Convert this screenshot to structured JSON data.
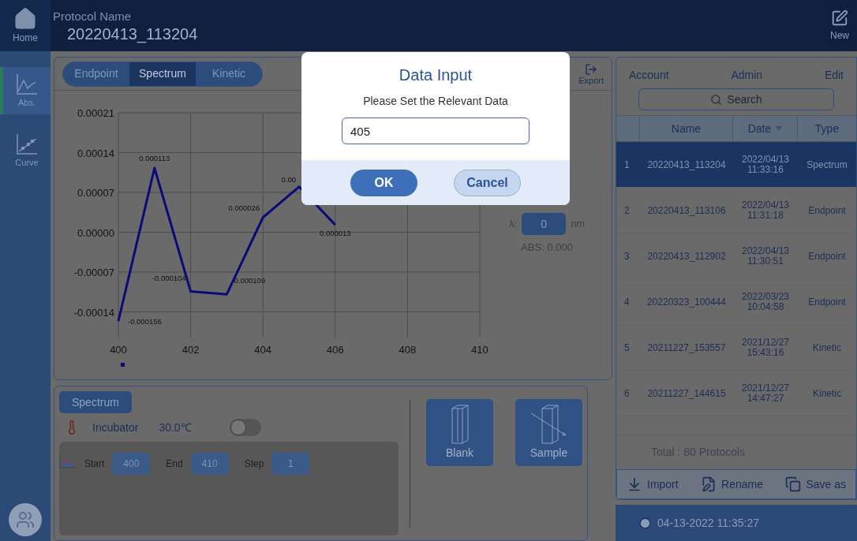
{
  "header": {
    "home_label": "Home",
    "protocol_label": "Protocol Name",
    "protocol_name": "20220413_113204",
    "new_label": "New"
  },
  "sidebar": [
    {
      "label": "Abs.",
      "kind": "abs",
      "selected": true
    },
    {
      "label": "Curve",
      "kind": "curve",
      "selected": false
    }
  ],
  "mode_tabs": [
    {
      "label": "Endpoint",
      "selected": false
    },
    {
      "label": "Spectrum",
      "selected": true
    },
    {
      "label": "Kinetic",
      "selected": false
    }
  ],
  "export_label": "Export",
  "chart": {
    "chart_data": {
      "type": "line",
      "x": [
        400,
        401,
        402,
        403,
        404,
        405,
        406
      ],
      "series": [
        {
          "color": "#0b0b78",
          "values": [
            -0.000156,
            0.000113,
            -0.000104,
            -0.000109,
            2.6e-05,
            8e-05,
            1.3e-05
          ]
        }
      ],
      "grid": true,
      "xlim": [
        400,
        410
      ],
      "ylim": [
        -0.000185,
        0.00021
      ],
      "xticks": [
        400,
        402,
        404,
        406,
        408,
        410
      ],
      "yticks": [
        {
          "value": 0.00021,
          "label": "0.00021"
        },
        {
          "value": 0.00014,
          "label": "0.00014"
        },
        {
          "value": 7e-05,
          "label": "0.00007"
        },
        {
          "value": 0,
          "label": "0.00000"
        },
        {
          "value": -7e-05,
          "label": "-0.00007"
        },
        {
          "value": -0.00014,
          "label": "-0.00014"
        }
      ],
      "value_labels": [
        "-0.000156",
        "0.000113",
        "-0.000104",
        "-0.000109",
        "0.000026",
        "0.00",
        "0.000013"
      ]
    }
  },
  "wavelength": {
    "label": "λ:",
    "value": "0",
    "unit": "nm",
    "abs": "ABS: 0.000"
  },
  "settings": {
    "tag": "Spectrum",
    "incubator_label": "Incubator",
    "temperature": "30.0℃",
    "incubator_on": false,
    "start_label": "Start",
    "start": "400",
    "end_label": "End",
    "end": "410",
    "step_label": "Step",
    "step": "1"
  },
  "measure_buttons": [
    {
      "label": "Blank",
      "kind": "blank"
    },
    {
      "label": "Sample",
      "kind": "sample"
    }
  ],
  "protocols": {
    "menu": [
      "Account",
      "Admin",
      "Edit"
    ],
    "search_placeholder": "Search",
    "columns": [
      "Name",
      "Date",
      "Type"
    ],
    "rows": [
      {
        "index": "1",
        "name": "20220413_113204",
        "date": "2022/04/13",
        "time": "11:33:16",
        "type": "Spectrum",
        "selected": true
      },
      {
        "index": "2",
        "name": "20220413_113106",
        "date": "2022/04/13",
        "time": "11:31:18",
        "type": "Endpoint",
        "selected": false
      },
      {
        "index": "3",
        "name": "20220413_112902",
        "date": "2022/04/13",
        "time": "11:30:51",
        "type": "Endpoint",
        "selected": false
      },
      {
        "index": "4",
        "name": "20220323_100444",
        "date": "2022/03/23",
        "time": "10:04:58",
        "type": "Endpoint",
        "selected": false
      },
      {
        "index": "5",
        "name": "20211227_153557",
        "date": "2021/12/27",
        "time": "15:43:16",
        "type": "Kinetic",
        "selected": false
      },
      {
        "index": "6",
        "name": "20211227_144615",
        "date": "2021/12/27",
        "time": "14:47:27",
        "type": "Kinetic",
        "selected": false
      }
    ],
    "total": "Total : 80 Protocols"
  },
  "actions": [
    {
      "label": "Import",
      "kind": "import"
    },
    {
      "label": "Rename",
      "kind": "rename"
    },
    {
      "label": "Save as",
      "kind": "save_as"
    }
  ],
  "status_bar": {
    "datetime": "04-13-2022 11:35:27"
  },
  "dialog": {
    "title": "Data Input",
    "message": "Please Set the Relevant Data",
    "value": "405",
    "buttons": [
      {
        "label": "OK",
        "kind": "primary"
      },
      {
        "label": "Cancel",
        "kind": "secondary"
      }
    ]
  }
}
